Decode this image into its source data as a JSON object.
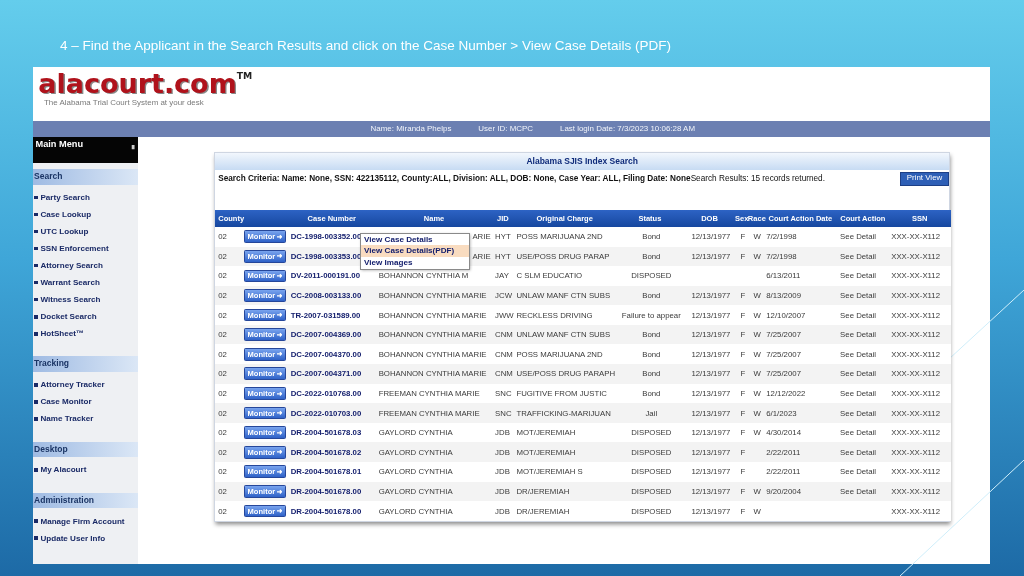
{
  "slide_title": "4 – Find the Applicant in the Search Results and click on the Case Number > View Case Details (PDF)",
  "logo": {
    "name": "alacourt.com",
    "mark": "TM",
    "tagline": "The Alabama Trial Court System at your desk"
  },
  "user_bar": [
    "Name: Miranda Phelps",
    "User ID: MCPC",
    "Last login Date: 7/3/2023 10:06:28 AM"
  ],
  "sidebar": {
    "header": "Main Menu",
    "sections": [
      {
        "title": "Search",
        "items": [
          "Party Search",
          "Case Lookup",
          "UTC Lookup",
          "SSN Enforcement",
          "Attorney Search",
          "Warrant Search",
          "Witness Search",
          "Docket Search",
          "HotSheet™"
        ]
      },
      {
        "title": "Tracking",
        "items": [
          "Attorney Tracker",
          "Case Monitor",
          "Name Tracker"
        ]
      },
      {
        "title": "Desktop",
        "items": [
          "My Alacourt"
        ]
      },
      {
        "title": "Administration",
        "items": [
          "Manage Firm Account",
          "Update User Info"
        ]
      }
    ]
  },
  "panel": {
    "title": "Alabama SJIS Index Search",
    "criteria": "**Search Criteria: Name: None, SSN: 422135112, County:ALL, Division: ALL, DOB: None, Case Year: ALL, Filing Date: None**Search Results: 15 records returned.",
    "print_button": "Print View"
  },
  "table": {
    "columns": [
      "County",
      "Case Number",
      "Name",
      "JID",
      "Original Charge",
      "Status",
      "DOB",
      "Sex",
      "Race",
      "Court Action Date",
      "Court Action",
      "SSN"
    ],
    "rows": [
      {
        "county": "02",
        "monitor": "Monitor",
        "case_number": "DC-1998-003352.00",
        "name": "ARIE",
        "jid": "HYT",
        "charge": "POSS MARIJUANA 2ND",
        "status": "Bond",
        "dob": "12/13/1977",
        "sex": "F",
        "race": "W",
        "action_date": "7/2/1998",
        "court_action": "See Detail",
        "ssn": "XXX-XX-X112"
      },
      {
        "county": "02",
        "monitor": "Monitor",
        "case_number": "DC-1998-003353.00",
        "name": "ARIE",
        "jid": "HYT",
        "charge": "USE/POSS DRUG PARAP",
        "status": "Bond",
        "dob": "12/13/1977",
        "sex": "F",
        "race": "W",
        "action_date": "7/2/1998",
        "court_action": "See Detail",
        "ssn": "XXX-XX-X112"
      },
      {
        "county": "02",
        "monitor": "Monitor",
        "case_number": "DV-2011-000191.00",
        "name": "BOHANNON CYNTHIA M",
        "jid": "JAY",
        "charge": "C SLM EDUCATIO",
        "status": "DISPOSED",
        "action_date": "6/13/2011",
        "court_action": "See Detail",
        "ssn": "XXX-XX-X112"
      },
      {
        "county": "02",
        "monitor": "Monitor",
        "case_number": "CC-2008-003133.00",
        "name": "BOHANNON CYNTHIA MARIE",
        "jid": "JCW",
        "charge": "UNLAW MANF CTN SUBS",
        "status": "Bond",
        "dob": "12/13/1977",
        "sex": "F",
        "race": "W",
        "action_date": "8/13/2009",
        "court_action": "See Detail",
        "ssn": "XXX-XX-X112"
      },
      {
        "county": "02",
        "monitor": "Monitor",
        "case_number": "TR-2007-031589.00",
        "name": "BOHANNON CYNTHIA MARIE",
        "jid": "JWW",
        "charge": "RECKLESS DRIVING",
        "status": "Failure to appear",
        "dob": "12/13/1977",
        "sex": "F",
        "race": "W",
        "action_date": "12/10/2007",
        "court_action": "See Detail",
        "ssn": "XXX-XX-X112"
      },
      {
        "county": "02",
        "monitor": "Monitor",
        "case_number": "DC-2007-004369.00",
        "name": "BOHANNON CYNTHIA MARIE",
        "jid": "CNM",
        "charge": "UNLAW MANF CTN SUBS",
        "status": "Bond",
        "dob": "12/13/1977",
        "sex": "F",
        "race": "W",
        "action_date": "7/25/2007",
        "court_action": "See Detail",
        "ssn": "XXX-XX-X112"
      },
      {
        "county": "02",
        "monitor": "Monitor",
        "case_number": "DC-2007-004370.00",
        "name": "BOHANNON CYNTHIA MARIE",
        "jid": "CNM",
        "charge": "POSS MARIJUANA 2ND",
        "status": "Bond",
        "dob": "12/13/1977",
        "sex": "F",
        "race": "W",
        "action_date": "7/25/2007",
        "court_action": "See Detail",
        "ssn": "XXX-XX-X112"
      },
      {
        "county": "02",
        "monitor": "Monitor",
        "case_number": "DC-2007-004371.00",
        "name": "BOHANNON CYNTHIA MARIE",
        "jid": "CNM",
        "charge": "USE/POSS DRUG PARAPH",
        "status": "Bond",
        "dob": "12/13/1977",
        "sex": "F",
        "race": "W",
        "action_date": "7/25/2007",
        "court_action": "See Detail",
        "ssn": "XXX-XX-X112"
      },
      {
        "county": "02",
        "monitor": "Monitor",
        "case_number": "DC-2022-010768.00",
        "name": "FREEMAN CYNTHIA MARIE",
        "jid": "SNC",
        "charge": "FUGITIVE FROM JUSTIC",
        "status": "Bond",
        "dob": "12/13/1977",
        "sex": "F",
        "race": "W",
        "action_date": "12/12/2022",
        "court_action": "See Detail",
        "ssn": "XXX-XX-X112"
      },
      {
        "county": "02",
        "monitor": "Monitor",
        "case_number": "DC-2022-010703.00",
        "name": "FREEMAN CYNTHIA MARIE",
        "jid": "SNC",
        "charge": "TRAFFICKING-MARIJUAN",
        "status": "Jail",
        "dob": "12/13/1977",
        "sex": "F",
        "race": "W",
        "action_date": "6/1/2023",
        "court_action": "See Detail",
        "ssn": "XXX-XX-X112"
      },
      {
        "county": "02",
        "monitor": "Monitor",
        "case_number": "DR-2004-501678.03",
        "name": "GAYLORD CYNTHIA",
        "jid": "JDB",
        "charge": "MOT/JEREMIAH",
        "status": "DISPOSED",
        "dob": "12/13/1977",
        "sex": "F",
        "race": "W",
        "action_date": "4/30/2014",
        "court_action": "See Detail",
        "ssn": "XXX-XX-X112"
      },
      {
        "county": "02",
        "monitor": "Monitor",
        "case_number": "DR-2004-501678.02",
        "name": "GAYLORD CYNTHIA",
        "jid": "JDB",
        "charge": "MOT/JEREMIAH",
        "status": "DISPOSED",
        "dob": "12/13/1977",
        "sex": "F",
        "action_date": "2/22/2011",
        "court_action": "See Detail",
        "ssn": "XXX-XX-X112"
      },
      {
        "county": "02",
        "monitor": "Monitor",
        "case_number": "DR-2004-501678.01",
        "name": "GAYLORD CYNTHIA",
        "jid": "JDB",
        "charge": "MOT/JEREMIAH S",
        "status": "DISPOSED",
        "dob": "12/13/1977",
        "sex": "F",
        "action_date": "2/22/2011",
        "court_action": "See Detail",
        "ssn": "XXX-XX-X112"
      },
      {
        "county": "02",
        "monitor": "Monitor",
        "case_number": "DR-2004-501678.00",
        "name": "GAYLORD CYNTHIA",
        "jid": "JDB",
        "charge": "DR/JEREMIAH",
        "status": "DISPOSED",
        "dob": "12/13/1977",
        "sex": "F",
        "race": "W",
        "action_date": "9/20/2004",
        "court_action": "See Detail",
        "ssn": "XXX-XX-X112"
      },
      {
        "county": "02",
        "monitor": "Monitor",
        "case_number": "DR-2004-501678.00",
        "name": "GAYLORD CYNTHIA",
        "jid": "JDB",
        "charge": "DR/JEREMIAH",
        "status": "DISPOSED",
        "dob": "12/13/1977",
        "sex": "F",
        "race": "W",
        "ssn": "XXX-XX-X112"
      }
    ]
  },
  "context_menu": [
    {
      "label": "View Case Details",
      "selected": false
    },
    {
      "label": "View Case Details(PDF)",
      "selected": true
    },
    {
      "label": "View Images",
      "selected": false
    }
  ]
}
